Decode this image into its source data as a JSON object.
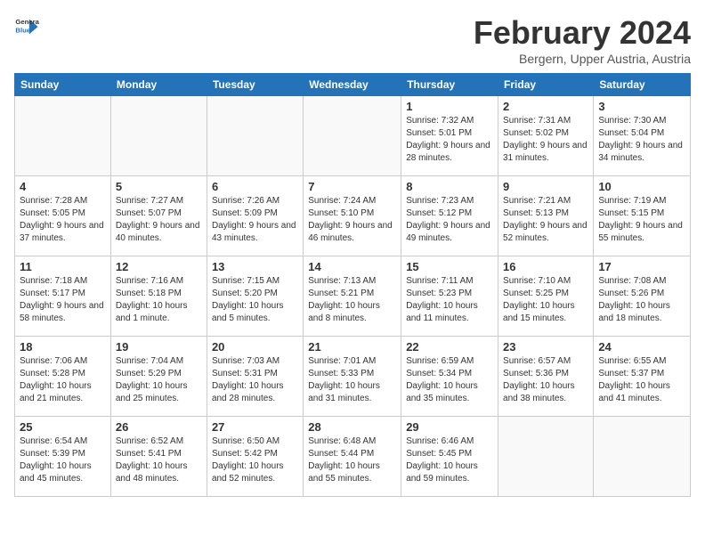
{
  "header": {
    "logo_line1": "General",
    "logo_line2": "Blue",
    "month_title": "February 2024",
    "location": "Bergern, Upper Austria, Austria"
  },
  "weekdays": [
    "Sunday",
    "Monday",
    "Tuesday",
    "Wednesday",
    "Thursday",
    "Friday",
    "Saturday"
  ],
  "weeks": [
    [
      {
        "day": "",
        "info": ""
      },
      {
        "day": "",
        "info": ""
      },
      {
        "day": "",
        "info": ""
      },
      {
        "day": "",
        "info": ""
      },
      {
        "day": "1",
        "info": "Sunrise: 7:32 AM\nSunset: 5:01 PM\nDaylight: 9 hours and 28 minutes."
      },
      {
        "day": "2",
        "info": "Sunrise: 7:31 AM\nSunset: 5:02 PM\nDaylight: 9 hours and 31 minutes."
      },
      {
        "day": "3",
        "info": "Sunrise: 7:30 AM\nSunset: 5:04 PM\nDaylight: 9 hours and 34 minutes."
      }
    ],
    [
      {
        "day": "4",
        "info": "Sunrise: 7:28 AM\nSunset: 5:05 PM\nDaylight: 9 hours and 37 minutes."
      },
      {
        "day": "5",
        "info": "Sunrise: 7:27 AM\nSunset: 5:07 PM\nDaylight: 9 hours and 40 minutes."
      },
      {
        "day": "6",
        "info": "Sunrise: 7:26 AM\nSunset: 5:09 PM\nDaylight: 9 hours and 43 minutes."
      },
      {
        "day": "7",
        "info": "Sunrise: 7:24 AM\nSunset: 5:10 PM\nDaylight: 9 hours and 46 minutes."
      },
      {
        "day": "8",
        "info": "Sunrise: 7:23 AM\nSunset: 5:12 PM\nDaylight: 9 hours and 49 minutes."
      },
      {
        "day": "9",
        "info": "Sunrise: 7:21 AM\nSunset: 5:13 PM\nDaylight: 9 hours and 52 minutes."
      },
      {
        "day": "10",
        "info": "Sunrise: 7:19 AM\nSunset: 5:15 PM\nDaylight: 9 hours and 55 minutes."
      }
    ],
    [
      {
        "day": "11",
        "info": "Sunrise: 7:18 AM\nSunset: 5:17 PM\nDaylight: 9 hours and 58 minutes."
      },
      {
        "day": "12",
        "info": "Sunrise: 7:16 AM\nSunset: 5:18 PM\nDaylight: 10 hours and 1 minute."
      },
      {
        "day": "13",
        "info": "Sunrise: 7:15 AM\nSunset: 5:20 PM\nDaylight: 10 hours and 5 minutes."
      },
      {
        "day": "14",
        "info": "Sunrise: 7:13 AM\nSunset: 5:21 PM\nDaylight: 10 hours and 8 minutes."
      },
      {
        "day": "15",
        "info": "Sunrise: 7:11 AM\nSunset: 5:23 PM\nDaylight: 10 hours and 11 minutes."
      },
      {
        "day": "16",
        "info": "Sunrise: 7:10 AM\nSunset: 5:25 PM\nDaylight: 10 hours and 15 minutes."
      },
      {
        "day": "17",
        "info": "Sunrise: 7:08 AM\nSunset: 5:26 PM\nDaylight: 10 hours and 18 minutes."
      }
    ],
    [
      {
        "day": "18",
        "info": "Sunrise: 7:06 AM\nSunset: 5:28 PM\nDaylight: 10 hours and 21 minutes."
      },
      {
        "day": "19",
        "info": "Sunrise: 7:04 AM\nSunset: 5:29 PM\nDaylight: 10 hours and 25 minutes."
      },
      {
        "day": "20",
        "info": "Sunrise: 7:03 AM\nSunset: 5:31 PM\nDaylight: 10 hours and 28 minutes."
      },
      {
        "day": "21",
        "info": "Sunrise: 7:01 AM\nSunset: 5:33 PM\nDaylight: 10 hours and 31 minutes."
      },
      {
        "day": "22",
        "info": "Sunrise: 6:59 AM\nSunset: 5:34 PM\nDaylight: 10 hours and 35 minutes."
      },
      {
        "day": "23",
        "info": "Sunrise: 6:57 AM\nSunset: 5:36 PM\nDaylight: 10 hours and 38 minutes."
      },
      {
        "day": "24",
        "info": "Sunrise: 6:55 AM\nSunset: 5:37 PM\nDaylight: 10 hours and 41 minutes."
      }
    ],
    [
      {
        "day": "25",
        "info": "Sunrise: 6:54 AM\nSunset: 5:39 PM\nDaylight: 10 hours and 45 minutes."
      },
      {
        "day": "26",
        "info": "Sunrise: 6:52 AM\nSunset: 5:41 PM\nDaylight: 10 hours and 48 minutes."
      },
      {
        "day": "27",
        "info": "Sunrise: 6:50 AM\nSunset: 5:42 PM\nDaylight: 10 hours and 52 minutes."
      },
      {
        "day": "28",
        "info": "Sunrise: 6:48 AM\nSunset: 5:44 PM\nDaylight: 10 hours and 55 minutes."
      },
      {
        "day": "29",
        "info": "Sunrise: 6:46 AM\nSunset: 5:45 PM\nDaylight: 10 hours and 59 minutes."
      },
      {
        "day": "",
        "info": ""
      },
      {
        "day": "",
        "info": ""
      }
    ]
  ]
}
